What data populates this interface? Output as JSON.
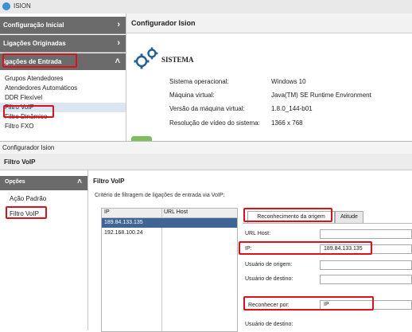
{
  "top_window": {
    "title": "ISION",
    "sidebar": {
      "headers": [
        {
          "label": "Configuração Inicial",
          "chevron": "›"
        },
        {
          "label": "Ligações Originadas",
          "chevron": "›"
        },
        {
          "label": "igações de Entrada",
          "chevron": "˄"
        }
      ],
      "items": [
        "Grupos Atendedores",
        "Atendedores Automáticos",
        "DDR Flexível",
        "Filtro VoIP",
        "Filtro Dinâmico",
        "Filtro FXO"
      ]
    },
    "main": {
      "header": "Configurador Ision",
      "section_title": "SISTEMA",
      "info": [
        {
          "label": "Sistema operacional:",
          "value": "Windows 10"
        },
        {
          "label": "Máquina virtual:",
          "value": "Java(TM) SE Runtime Environment"
        },
        {
          "label": "Versão da máquina virtual:",
          "value": "1.8.0_144-b01"
        },
        {
          "label": "Resolução de vídeo do sistema:",
          "value": "1366 x 768"
        }
      ]
    }
  },
  "bottom_window": {
    "title": "Configurador Ision",
    "header": "Filtro VoIP",
    "sidebar": {
      "section": "Opções",
      "chevron": "˄",
      "items": [
        "Ação Padrão",
        "Filtro VoIP"
      ]
    },
    "main": {
      "title": "Filtro VoIP",
      "criteria": "Critério de filtragem de ligações de entrada via VoIP:",
      "table": {
        "columns": [
          "IP",
          "URL Host"
        ],
        "rows": [
          "189.84.133.135",
          "192.168.100.24"
        ]
      },
      "tabs": [
        "Reconhecimento da origem",
        "Atitude"
      ],
      "form": {
        "url_host_label": "URL Host:",
        "url_host_value": "",
        "ip_label": "IP:",
        "ip_value": "189.84.133.135",
        "origem_label": "Usuário de origem:",
        "destino_label": "Usuário de destino:",
        "reconhecer_label": "Reconhecer por:",
        "reconhecer_value": "IP",
        "destino2_label": "Usuário de destino:"
      }
    }
  },
  "colors": {
    "accordion_header": "#6b6b6b",
    "selected_row": "#3e6595",
    "highlight": "#e0101a"
  }
}
